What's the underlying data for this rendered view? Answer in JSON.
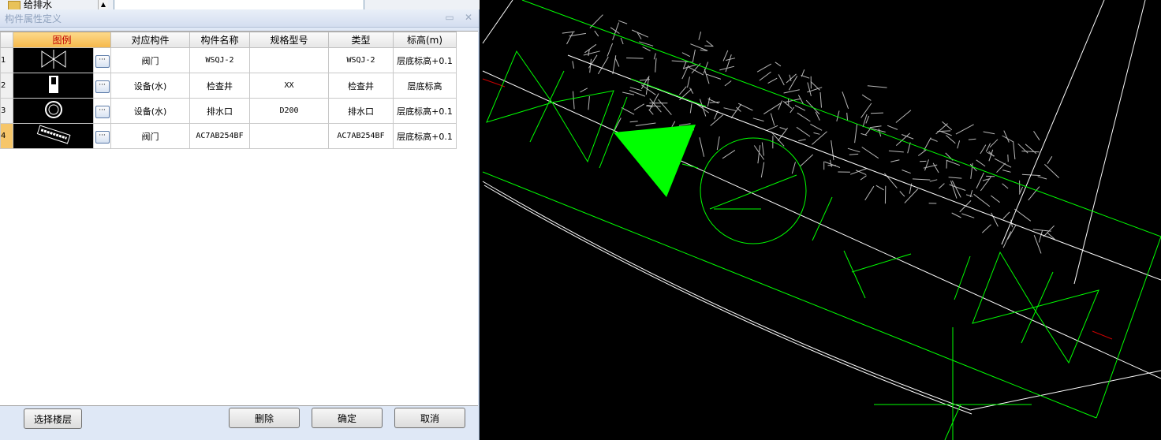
{
  "tree": {
    "item_label": "给排水"
  },
  "dialog": {
    "title": "构件属性定义",
    "columns": [
      "图例",
      "对应构件",
      "构件名称",
      "规格型号",
      "类型",
      "标高(m)"
    ],
    "rows": [
      {
        "num": "1",
        "component": "阀门",
        "name": "WSQJ-2",
        "spec": "",
        "type": "WSQJ-2",
        "elevation": "层底标高+0.1",
        "legend": "valve-icon"
      },
      {
        "num": "2",
        "component": "设备(水)",
        "name": "检查井",
        "spec": "XX",
        "type": "检查井",
        "elevation": "层底标高",
        "legend": "inspection-well-icon"
      },
      {
        "num": "3",
        "component": "设备(水)",
        "name": "排水口",
        "spec": "D200",
        "type": "排水口",
        "elevation": "层底标高+0.1",
        "legend": "drain-outlet-icon"
      },
      {
        "num": "4",
        "component": "阀门",
        "name": "AC7AB254BF",
        "spec": "",
        "type": "AC7AB254BF",
        "elevation": "层底标高+0.1",
        "legend": "block-text-icon"
      }
    ],
    "dots_label": "···",
    "buttons": {
      "select_floor": "选择楼层",
      "delete": "删除",
      "ok": "确定",
      "cancel": "取消"
    }
  },
  "colors": {
    "cad_green": "#00ff00",
    "cad_background": "#000000",
    "header_highlight": "#f5b74a"
  }
}
